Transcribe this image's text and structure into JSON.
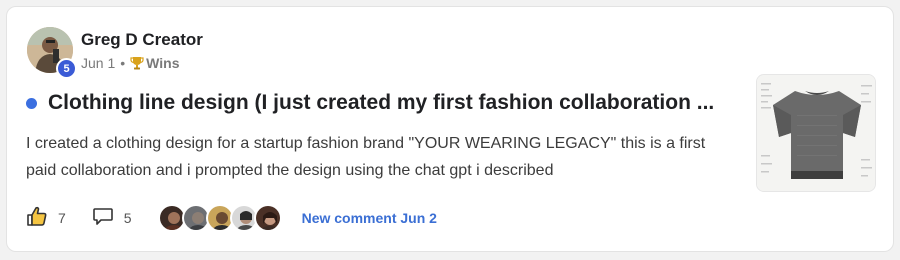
{
  "post": {
    "author": {
      "name": "Greg D Creator",
      "level": "5",
      "avatar_icon": "user-avatar-photo"
    },
    "meta": {
      "date": "Jun 1",
      "separator": "•",
      "category_icon": "trophy-icon",
      "category": "Wins"
    },
    "unread": true,
    "title": "Clothing line design (I just created my first fashion collaboration ...",
    "body": "I created a clothing design for a startup fashion brand \"YOUR WEARING LEGACY\" this is a first paid collaboration and i prompted the design using the chat gpt i described",
    "thumbnail_icon": "t-shirt-image"
  },
  "footer": {
    "likes": "7",
    "like_icon": "thumbs-up-icon",
    "comments": "5",
    "comment_icon": "comment-bubble-icon",
    "commenter_avatars": [
      {
        "name": "commenter-avatar-1",
        "color": "#6b3f2a"
      },
      {
        "name": "commenter-avatar-2",
        "color": "#55585e"
      },
      {
        "name": "commenter-avatar-3",
        "color": "#8a6a3b"
      },
      {
        "name": "commenter-avatar-4",
        "color": "#4d4d4d"
      },
      {
        "name": "commenter-avatar-5",
        "color": "#5c3b2e"
      }
    ],
    "new_comment_label": "New comment Jun 2"
  },
  "colors": {
    "accent": "#3b6fe0",
    "link": "#3b6fd4",
    "badge": "#3b5bd6"
  }
}
